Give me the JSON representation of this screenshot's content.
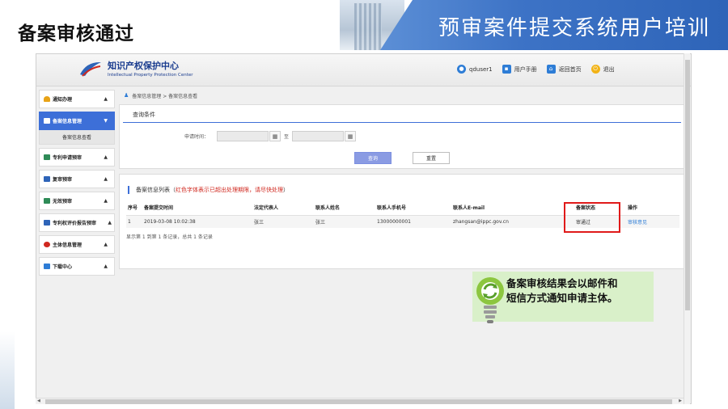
{
  "slide": {
    "title": "备案审核通过",
    "banner_title": "预审案件提交系统用户培训"
  },
  "header": {
    "org_cn": "知识产权保护中心",
    "org_en": "Intellectual Property Protection Center",
    "user": "qduser1",
    "manual": "用户手册",
    "home": "返回首页",
    "exit": "退出"
  },
  "sidebar": {
    "items": [
      {
        "label": "通知办理",
        "icon": "bell-icon",
        "color": "#e8a317"
      },
      {
        "label": "备案信息管理",
        "icon": "folder-icon",
        "color": "#ffffff",
        "active": true
      },
      {
        "label": "专利申请预审",
        "icon": "document-icon",
        "color": "#2e8b57"
      },
      {
        "label": "复审预审",
        "icon": "folder-icon",
        "color": "#2e64b8"
      },
      {
        "label": "无效预审",
        "icon": "document-icon",
        "color": "#2e8b57"
      },
      {
        "label": "专利权评价报告预审",
        "icon": "folder-icon",
        "color": "#2e64b8"
      },
      {
        "label": "主体信息管理",
        "icon": "person-icon",
        "color": "#d0281f"
      },
      {
        "label": "下载中心",
        "icon": "download-icon",
        "color": "#2e7dd6"
      }
    ],
    "submenu": "备案信息查看"
  },
  "breadcrumb": "备案信息管理 > 备案信息查看",
  "query": {
    "title": "查询条件",
    "date_label": "申请时间：",
    "to": "至",
    "search": "查询",
    "reset": "重置"
  },
  "list": {
    "title": "备案信息列表（",
    "hint": "红色字体表示已超出处理期限，请尽快处理",
    "title_end": "）",
    "columns": [
      "序号",
      "备案提交时间",
      "法定代表人",
      "联系人姓名",
      "联系人手机号",
      "联系人E-mail",
      "备案状态",
      "操作"
    ],
    "rows": [
      [
        "1",
        "2019-03-08 10:02:38",
        "张三",
        "张三",
        "13000000001",
        "zhangsan@ippc.gov.cn",
        "审通过",
        "审核意见"
      ]
    ],
    "footer": "显示第 1 到第 1 条记录，总共 1 条记录"
  },
  "callout": {
    "line1": "备案审核结果会以邮件和",
    "line2": "短信方式通知申请主体。"
  },
  "colors": {
    "accent": "#3d6fd8",
    "highlight": "#e01a1a",
    "callout_bg": "#d9f0c9"
  }
}
